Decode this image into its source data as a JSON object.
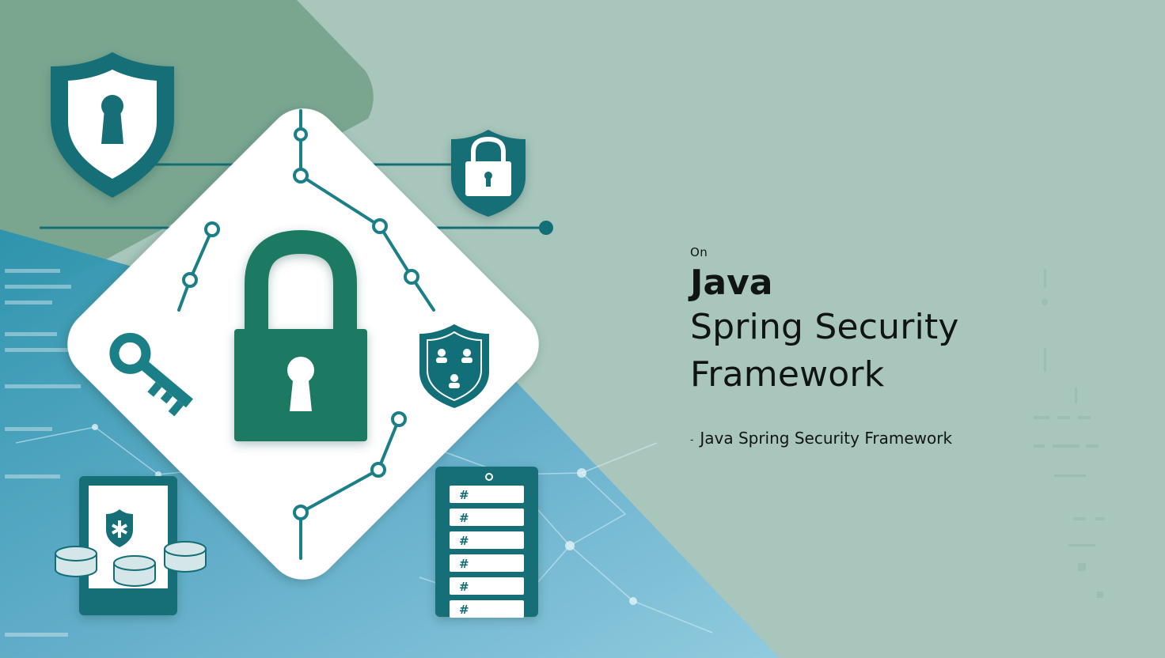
{
  "title_block": {
    "kicker": "On",
    "title_main": "Java",
    "title_line_1": "Spring Security",
    "title_line_2": "Framework"
  },
  "subtitle": {
    "dash": "-",
    "text": "Java Spring Security Framework"
  },
  "palette": {
    "background": "#a9c6bc",
    "upper_left_panel": "#7aa690",
    "teal_dark": "#126e77",
    "green_dark": "#1e7a63",
    "lower_blue": "#6db3cc",
    "card": "#ffffff"
  },
  "icons": [
    "shield-keyhole-icon",
    "shield-padlock-icon",
    "padlock-icon",
    "key-icon",
    "shield-users-icon",
    "tablet-shield-icon",
    "database-icon",
    "server-rack-icon"
  ],
  "rack_rows": [
    "#",
    "#",
    "#",
    "#",
    "#",
    "#"
  ]
}
